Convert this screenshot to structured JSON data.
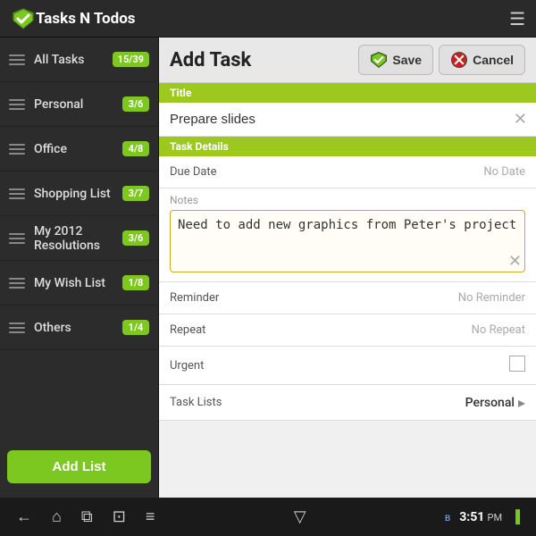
{
  "app": {
    "title": "Tasks N Todos",
    "menu_icon": "☰"
  },
  "sidebar": {
    "items": [
      {
        "id": "all-tasks",
        "label": "All Tasks",
        "badge": "15/39"
      },
      {
        "id": "personal",
        "label": "Personal",
        "badge": "3/6"
      },
      {
        "id": "office",
        "label": "Office",
        "badge": "4/8"
      },
      {
        "id": "shopping-list",
        "label": "Shopping List",
        "badge": "3/7"
      },
      {
        "id": "my-2012-resolutions",
        "label": "My 2012 Resolutions",
        "badge": "3/6"
      },
      {
        "id": "my-wish-list",
        "label": "My Wish List",
        "badge": "1/8"
      },
      {
        "id": "others",
        "label": "Others",
        "badge": "1/4"
      }
    ],
    "add_list_label": "Add List"
  },
  "content": {
    "header_title": "Add Task",
    "save_label": "Save",
    "cancel_label": "Cancel",
    "sections": {
      "title_header": "Title",
      "task_details_header": "Task Details"
    },
    "form": {
      "title_value": "Prepare slides",
      "title_placeholder": "Prepare slides",
      "due_date_label": "Due Date",
      "due_date_value": "No Date",
      "notes_label": "Notes",
      "notes_value": "Need to add new graphics from Peter's project",
      "reminder_label": "Reminder",
      "reminder_value": "No Reminder",
      "repeat_label": "Repeat",
      "repeat_value": "No Repeat",
      "urgent_label": "Urgent",
      "task_lists_label": "Task Lists",
      "task_lists_value": "Personal"
    }
  },
  "bottom_bar": {
    "time": "3:51",
    "ampm": "PM",
    "back_icon": "←",
    "home_icon": "⌂",
    "recent_icon": "⧉",
    "screenshot_icon": "⊡",
    "menu_icon": "≡",
    "center_icon": "▽",
    "bluetooth_icon": "ʙ"
  }
}
